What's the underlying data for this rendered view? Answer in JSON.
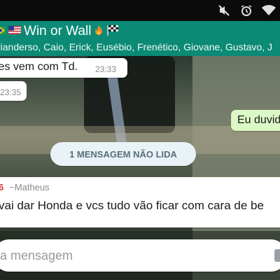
{
  "chat": {
    "title": "Win or Wall",
    "title_prefix_flags": [
      "flag-brazil-icon",
      "flag-usa-icon"
    ],
    "title_suffix_icons": [
      "fire-icon",
      "checkered-flag-icon"
    ],
    "participants": "rianderso, Caio, Erick, Eusébio, Frenético, Giovane, Gustavo, J"
  },
  "status_icons": [
    "mute-icon",
    "alarm-icon",
    "wifi-icon"
  ],
  "messages": [
    {
      "text": "les vem com Td.",
      "time": "23:33",
      "direction": "incoming"
    },
    {
      "text": "",
      "time": "23:35",
      "direction": "incoming"
    },
    {
      "text": "Eu duvid",
      "time": "",
      "direction": "outgoing"
    }
  ],
  "unread_banner": "1 MENSAGEM NÃO LIDA",
  "unread_message": {
    "sender_phone_fragment": "6",
    "sender_name": "~Matheus",
    "text": "vai dar Honda e vcs tudo vão ficar com cara de be"
  },
  "composer": {
    "placeholder": "a mensagem"
  },
  "colors": {
    "header": "#0b8a76",
    "outgoing_bubble": "#dcf8c6",
    "sender_name": "#d23c3c",
    "unread_banner": "#e9f2f6"
  }
}
